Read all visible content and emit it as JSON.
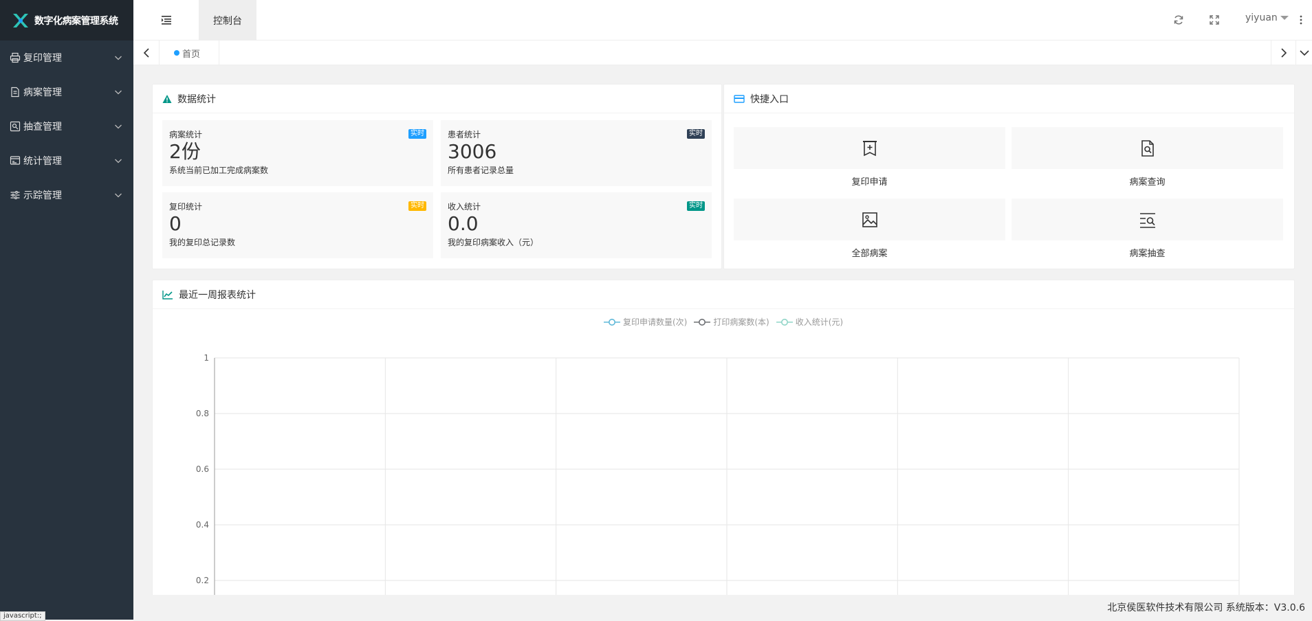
{
  "app": {
    "title": "数字化病案管理系统"
  },
  "sidebar": {
    "items": [
      {
        "label": "复印管理",
        "icon": "printer-icon"
      },
      {
        "label": "病案管理",
        "icon": "file-icon"
      },
      {
        "label": "抽查管理",
        "icon": "inspect-icon"
      },
      {
        "label": "统计管理",
        "icon": "chart-icon"
      },
      {
        "label": "示踪管理",
        "icon": "sliders-icon"
      }
    ]
  },
  "header": {
    "console_tab": "控制台",
    "username": "yiyuan"
  },
  "tabbar": {
    "home_label": "首页"
  },
  "data_stats": {
    "title": "数据统计",
    "cards": [
      {
        "title": "病案统计",
        "value": "2份",
        "desc": "系统当前已加工完成病案数",
        "badge": "实时",
        "badge_color": "#1e9fff"
      },
      {
        "title": "患者统计",
        "value": "3006",
        "desc": "所有患者记录总量",
        "badge": "实时",
        "badge_color": "#2f4056"
      },
      {
        "title": "复印统计",
        "value": "0",
        "desc": "我的复印总记录数",
        "badge": "实时",
        "badge_color": "#ffb800"
      },
      {
        "title": "收入统计",
        "value": "0.0",
        "desc": "我的复印病案收入（元）",
        "badge": "实时",
        "badge_color": "#009688"
      }
    ]
  },
  "quick_entry": {
    "title": "快捷入口",
    "items": [
      {
        "label": "复印申请",
        "icon": "copy-request-icon"
      },
      {
        "label": "病案查询",
        "icon": "file-search-icon"
      },
      {
        "label": "全部病案",
        "icon": "image-icon"
      },
      {
        "label": "病案抽查",
        "icon": "list-search-icon"
      }
    ]
  },
  "weekly_report": {
    "title": "最近一周报表统计"
  },
  "chart_data": {
    "type": "line",
    "series": [
      {
        "name": "复印申请数量(次)",
        "color": "#5fb8d8",
        "values": []
      },
      {
        "name": "打印病案数(本)",
        "color": "#6e7074",
        "values": []
      },
      {
        "name": "收入统计(元)",
        "color": "#91d5c8",
        "values": []
      }
    ],
    "y_ticks": [
      "1",
      "0.8",
      "0.6",
      "0.4",
      "0.2"
    ],
    "ylim": [
      0,
      1
    ],
    "x_categories": 6,
    "grid": true,
    "legend": "top-center"
  },
  "footer": {
    "text": "北京侯医软件技术有限公司 系统版本：V3.0.6"
  },
  "status_bar": {
    "text": "javascript:;"
  }
}
